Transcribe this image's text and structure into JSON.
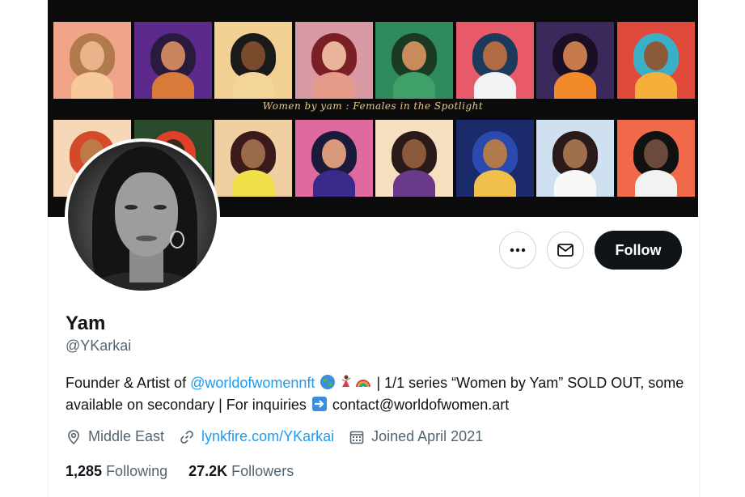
{
  "banner": {
    "tagline": "Women by yam : Females in the Spotlight",
    "tiles_row1": [
      {
        "bg": "#f0a48a",
        "hair": "#b07a4c",
        "skin": "#e9b48c",
        "body": "#f6c89a"
      },
      {
        "bg": "#5b2a8c",
        "hair": "#2a1a3c",
        "skin": "#c98560",
        "body": "#d77a3a"
      },
      {
        "bg": "#f2cf92",
        "hair": "#1a1a1a",
        "skin": "#7a4a2c",
        "body": "#f3d59a"
      },
      {
        "bg": "#d99aa6",
        "hair": "#7a1f24",
        "skin": "#e8b49a",
        "body": "#e59a8a"
      },
      {
        "bg": "#2f8a5c",
        "hair": "#1a3a24",
        "skin": "#c98a5c",
        "body": "#3fa06a"
      },
      {
        "bg": "#e85a6a",
        "hair": "#1b3a5c",
        "skin": "#b06a44",
        "body": "#f2f2f2"
      },
      {
        "bg": "#3a2a5c",
        "hair": "#1a0f24",
        "skin": "#c87a4c",
        "body": "#f28a2a"
      },
      {
        "bg": "#e04a3a",
        "hair": "#3ab0c8",
        "skin": "#8a5a3a",
        "body": "#f4b03a"
      }
    ],
    "tiles_row2": [
      {
        "bg": "#f6d8b8",
        "hair": "#d24a2a",
        "skin": "#c07a4a",
        "body": "#f0a060"
      },
      {
        "bg": "#2a4a2a",
        "hair": "#e0402a",
        "skin": "#3a2a1a",
        "body": "#4a7a3a"
      },
      {
        "bg": "#f0d0a0",
        "hair": "#3a1a1a",
        "skin": "#9a6a4a",
        "body": "#f2e04a"
      },
      {
        "bg": "#e06aa0",
        "hair": "#1a1a3a",
        "skin": "#d89a7a",
        "body": "#3a2a8a"
      },
      {
        "bg": "#f6e0c0",
        "hair": "#2a1a1a",
        "skin": "#8a5a3a",
        "body": "#6a3a8a"
      },
      {
        "bg": "#1a2a6a",
        "hair": "#2a4ab0",
        "skin": "#b07a4a",
        "body": "#f0c04a"
      },
      {
        "bg": "#cfe0f0",
        "hair": "#2a1a1a",
        "skin": "#a0704a",
        "body": "#f8f8f8"
      },
      {
        "bg": "#f06a4a",
        "hair": "#111111",
        "skin": "#6a4a3a",
        "body": "#f2f2f2"
      }
    ]
  },
  "actions": {
    "more_icon": "more-horizontal-icon",
    "message_icon": "envelope-icon",
    "follow_label": "Follow"
  },
  "profile": {
    "name": "Yam",
    "handle": "@YKarkai",
    "bio_prefix": "Founder & Artist of ",
    "bio_mention": "@worldofwomennft",
    "bio_middle": " | 1/1 series “Women by Yam” SOLD OUT, some available on secondary | For inquiries ",
    "bio_suffix": " contact@worldofwomen.art",
    "location": "Middle East",
    "website": "lynkfire.com/YKarkai",
    "joined": "Joined April 2021"
  },
  "stats": {
    "following_count": "1,285",
    "following_label": "Following",
    "followers_count": "27.2K",
    "followers_label": "Followers"
  },
  "colors": {
    "accent": "#1d9bf0",
    "text": "#0f1419",
    "secondary": "#536471"
  }
}
